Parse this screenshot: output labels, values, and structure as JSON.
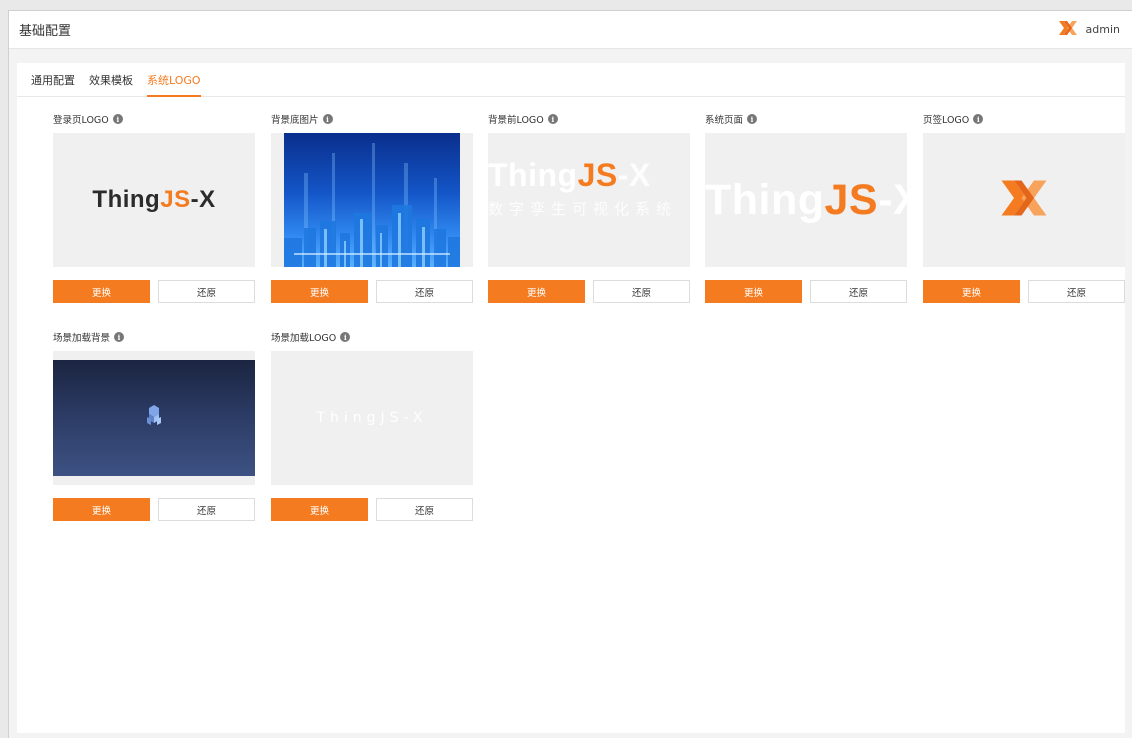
{
  "header": {
    "title": "基础配置",
    "user_name": "admin",
    "logo_icon": "thingjs-x-icon"
  },
  "tabs": [
    {
      "label": "通用配置",
      "active": false
    },
    {
      "label": "效果模板",
      "active": false
    },
    {
      "label": "系统LOGO",
      "active": true
    }
  ],
  "colors": {
    "accent": "#f47b20",
    "info_icon": "#777777",
    "city_bg_top": "#0a2e8c",
    "scene_bg_top": "#1b2541"
  },
  "info_glyph": "i",
  "cards": [
    {
      "label": "登录页LOGO",
      "preview_text_a": "Thing",
      "preview_text_b": "JS",
      "preview_text_c": "-X",
      "replace": "更换",
      "restore": "还原"
    },
    {
      "label": "背景底图片",
      "replace": "更换",
      "restore": "还原"
    },
    {
      "label": "背景前LOGO",
      "preview_text_a": "Thing",
      "preview_text_b": "JS",
      "preview_text_c": "-X",
      "slogan": "数字孪生可视化系统",
      "replace": "更换",
      "restore": "还原"
    },
    {
      "label": "系统页面",
      "preview_text_a": "Thing",
      "preview_text_b": "JS",
      "preview_text_c": "-X",
      "replace": "更换",
      "restore": "还原"
    },
    {
      "label": "页签LOGO",
      "replace": "更换",
      "restore": "还原"
    },
    {
      "label": "场景加载背景",
      "replace": "更换",
      "restore": "还原"
    },
    {
      "label": "场景加载LOGO",
      "preview_text": "ThingJS-X",
      "replace": "更换",
      "restore": "还原"
    }
  ]
}
